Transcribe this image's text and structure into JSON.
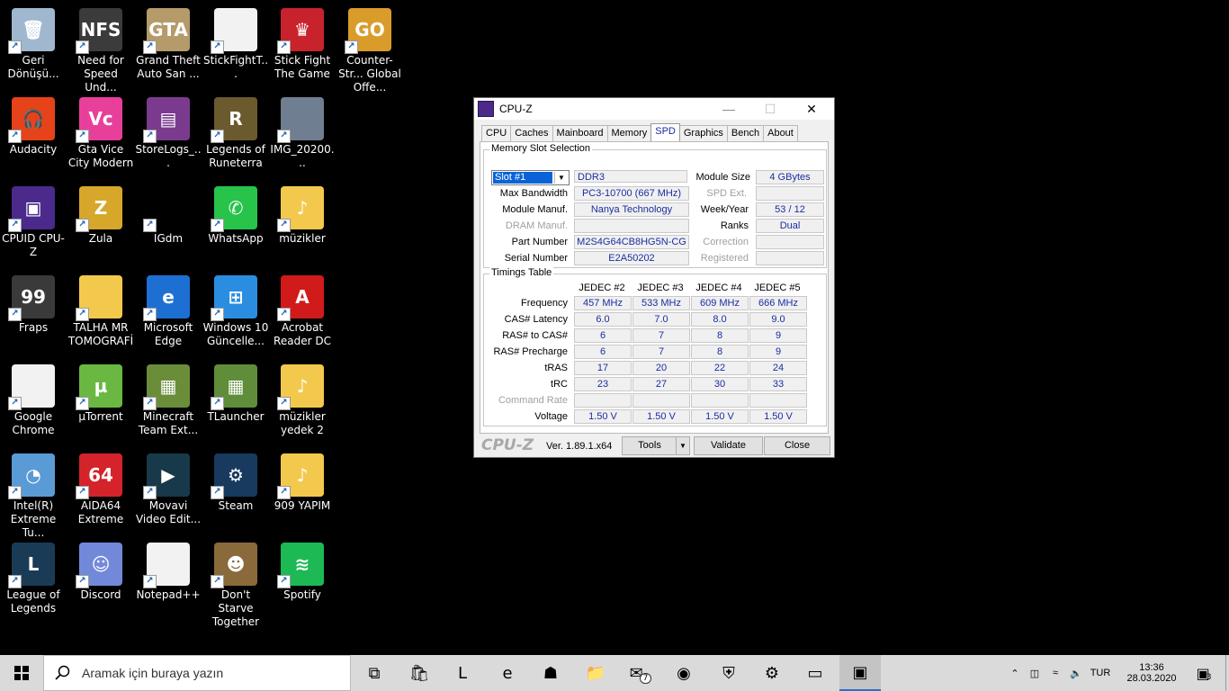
{
  "desktop": {
    "icons": [
      {
        "label": "Geri Dönüşü...",
        "icon": "recycle-bin-icon",
        "color": "#9fb8cf",
        "glyph": "🗑"
      },
      {
        "label": "Need for Speed Und...",
        "icon": "nfs-icon",
        "color": "#3b3b3b",
        "glyph": "NFS"
      },
      {
        "label": "Grand Theft Auto San ...",
        "icon": "gta-sa-icon",
        "color": "#b59a6a",
        "glyph": "GTA"
      },
      {
        "label": "StickFightT...",
        "icon": "stickfight-file-icon",
        "color": "#f2f2f2",
        "glyph": ""
      },
      {
        "label": "Stick Fight The Game",
        "icon": "stick-fight-icon",
        "color": "#c8232c",
        "glyph": "♛"
      },
      {
        "label": "Counter-Str... Global Offe...",
        "icon": "csgo-icon",
        "color": "#d99c2a",
        "glyph": "GO"
      },
      {
        "label": "Audacity",
        "icon": "audacity-icon",
        "color": "#e6431b",
        "glyph": "🎧"
      },
      {
        "label": "Gta Vice City Modern",
        "icon": "gta-vc-icon",
        "color": "#e8409a",
        "glyph": "Vc"
      },
      {
        "label": "StoreLogs_...",
        "icon": "winrar-icon",
        "color": "#7a3b8f",
        "glyph": "▤"
      },
      {
        "label": "Legends of Runeterra",
        "icon": "runeterra-icon",
        "color": "#6b5a2e",
        "glyph": "R"
      },
      {
        "label": "IMG_20200...",
        "icon": "image-file-icon",
        "color": "#6f7f91",
        "glyph": ""
      },
      {
        "label": "CPUID CPU-Z",
        "icon": "cpuz-icon",
        "color": "#4b2a8c",
        "glyph": "▣"
      },
      {
        "label": "Zula",
        "icon": "zula-icon",
        "color": "#d6a72a",
        "glyph": "Z"
      },
      {
        "label": "IGdm",
        "icon": "igdm-icon",
        "color": "#000000",
        "glyph": ""
      },
      {
        "label": "WhatsApp",
        "icon": "whatsapp-icon",
        "color": "#27c34a",
        "glyph": "✆"
      },
      {
        "label": "müzikler",
        "icon": "folder-music-icon",
        "color": "#f3c94d",
        "glyph": "♪"
      },
      {
        "label": "Fraps",
        "icon": "fraps-icon",
        "color": "#3a3a3a",
        "glyph": "99"
      },
      {
        "label": "TALHA MR TOMOGRAFİ",
        "icon": "folder-icon",
        "color": "#f3c94d",
        "glyph": ""
      },
      {
        "label": "Microsoft Edge",
        "icon": "edge-icon",
        "color": "#1e6fd2",
        "glyph": "e"
      },
      {
        "label": "Windows 10 Güncelle...",
        "icon": "windows-update-icon",
        "color": "#2a8de0",
        "glyph": "⊞"
      },
      {
        "label": "Acrobat Reader DC",
        "icon": "acrobat-icon",
        "color": "#d11a1a",
        "glyph": "A"
      },
      {
        "label": "Google Chrome",
        "icon": "chrome-file-icon",
        "color": "#f2f2f2",
        "glyph": ""
      },
      {
        "label": "µTorrent",
        "icon": "utorrent-icon",
        "color": "#6ab842",
        "glyph": "µ"
      },
      {
        "label": "Minecraft Team Ext...",
        "icon": "minecraft-icon",
        "color": "#6a8d3a",
        "glyph": "▦"
      },
      {
        "label": "TLauncher",
        "icon": "tlauncher-icon",
        "color": "#5f8d3a",
        "glyph": "▦"
      },
      {
        "label": "müzikler yedek 2",
        "icon": "folder-music-icon",
        "color": "#f3c94d",
        "glyph": "♪"
      },
      {
        "label": "Intel(R) Extreme Tu...",
        "icon": "intel-xtu-icon",
        "color": "#5a9bd6",
        "glyph": "◔"
      },
      {
        "label": "AIDA64 Extreme",
        "icon": "aida64-icon",
        "color": "#d4232a",
        "glyph": "64"
      },
      {
        "label": "Movavi Video Edit...",
        "icon": "movavi-icon",
        "color": "#18394a",
        "glyph": "▶"
      },
      {
        "label": "Steam",
        "icon": "steam-icon",
        "color": "#173a5e",
        "glyph": "⚙"
      },
      {
        "label": "909 YAPIM",
        "icon": "folder-music-icon",
        "color": "#f3c94d",
        "glyph": "♪"
      },
      {
        "label": "League of Legends",
        "icon": "lol-icon",
        "color": "#1a3b56",
        "glyph": "L"
      },
      {
        "label": "Discord",
        "icon": "discord-icon",
        "color": "#7289da",
        "glyph": "☺"
      },
      {
        "label": "Notepad++",
        "icon": "notepadpp-file-icon",
        "color": "#f2f2f2",
        "glyph": ""
      },
      {
        "label": "Don't Starve Together",
        "icon": "dont-starve-icon",
        "color": "#8a6a3a",
        "glyph": "☻"
      },
      {
        "label": "Spotify",
        "icon": "spotify-icon",
        "color": "#1db954",
        "glyph": "≋"
      }
    ]
  },
  "cpuz": {
    "title": "CPU-Z",
    "tabs": [
      "CPU",
      "Caches",
      "Mainboard",
      "Memory",
      "SPD",
      "Graphics",
      "Bench",
      "About"
    ],
    "active_tab": "SPD",
    "slot_group_title": "Memory Slot Selection",
    "slot_selected": "Slot #1",
    "memory_type": "DDR3",
    "labels": {
      "module_size": "Module Size",
      "max_bandwidth": "Max Bandwidth",
      "spd_ext": "SPD Ext.",
      "module_manuf": "Module Manuf.",
      "week_year": "Week/Year",
      "dram_manuf": "DRAM Manuf.",
      "ranks": "Ranks",
      "part_number": "Part Number",
      "correction": "Correction",
      "serial_number": "Serial Number",
      "registered": "Registered"
    },
    "values": {
      "module_size": "4 GBytes",
      "max_bandwidth": "PC3-10700 (667 MHz)",
      "spd_ext": "",
      "module_manuf": "Nanya Technology",
      "week_year": "53 / 12",
      "dram_manuf": "",
      "ranks": "Dual",
      "part_number": "M2S4G64CB8HG5N-CG",
      "correction": "",
      "serial_number": "E2A50202",
      "registered": ""
    },
    "timings_title": "Timings Table",
    "timing_columns": [
      "JEDEC #2",
      "JEDEC #3",
      "JEDEC #4",
      "JEDEC #5"
    ],
    "timing_rows": [
      {
        "label": "Frequency",
        "values": [
          "457 MHz",
          "533 MHz",
          "609 MHz",
          "666 MHz"
        ],
        "dim": false
      },
      {
        "label": "CAS# Latency",
        "values": [
          "6.0",
          "7.0",
          "8.0",
          "9.0"
        ],
        "dim": false
      },
      {
        "label": "RAS# to CAS#",
        "values": [
          "6",
          "7",
          "8",
          "9"
        ],
        "dim": false
      },
      {
        "label": "RAS# Precharge",
        "values": [
          "6",
          "7",
          "8",
          "9"
        ],
        "dim": false
      },
      {
        "label": "tRAS",
        "values": [
          "17",
          "20",
          "22",
          "24"
        ],
        "dim": false
      },
      {
        "label": "tRC",
        "values": [
          "23",
          "27",
          "30",
          "33"
        ],
        "dim": false
      },
      {
        "label": "Command Rate",
        "values": [
          "",
          "",
          "",
          ""
        ],
        "dim": true
      },
      {
        "label": "Voltage",
        "values": [
          "1.50 V",
          "1.50 V",
          "1.50 V",
          "1.50 V"
        ],
        "dim": false
      }
    ],
    "footer": {
      "logo": "CPU-Z",
      "version": "Ver. 1.89.1.x64",
      "tools": "Tools",
      "validate": "Validate",
      "close": "Close"
    }
  },
  "taskbar": {
    "search_placeholder": "Aramak için buraya yazın",
    "apps": [
      "task-view-icon",
      "store-icon",
      "lol-icon",
      "edge-icon",
      "gta-icon",
      "file-explorer-icon",
      "mail-icon",
      "chrome-icon",
      "security-icon",
      "network-app-icon",
      "terminal-icon",
      "cpuz-icon"
    ],
    "mail_badge": "7",
    "language": "TUR",
    "time": "13:36",
    "date": "28.03.2020",
    "notifications": "3"
  }
}
